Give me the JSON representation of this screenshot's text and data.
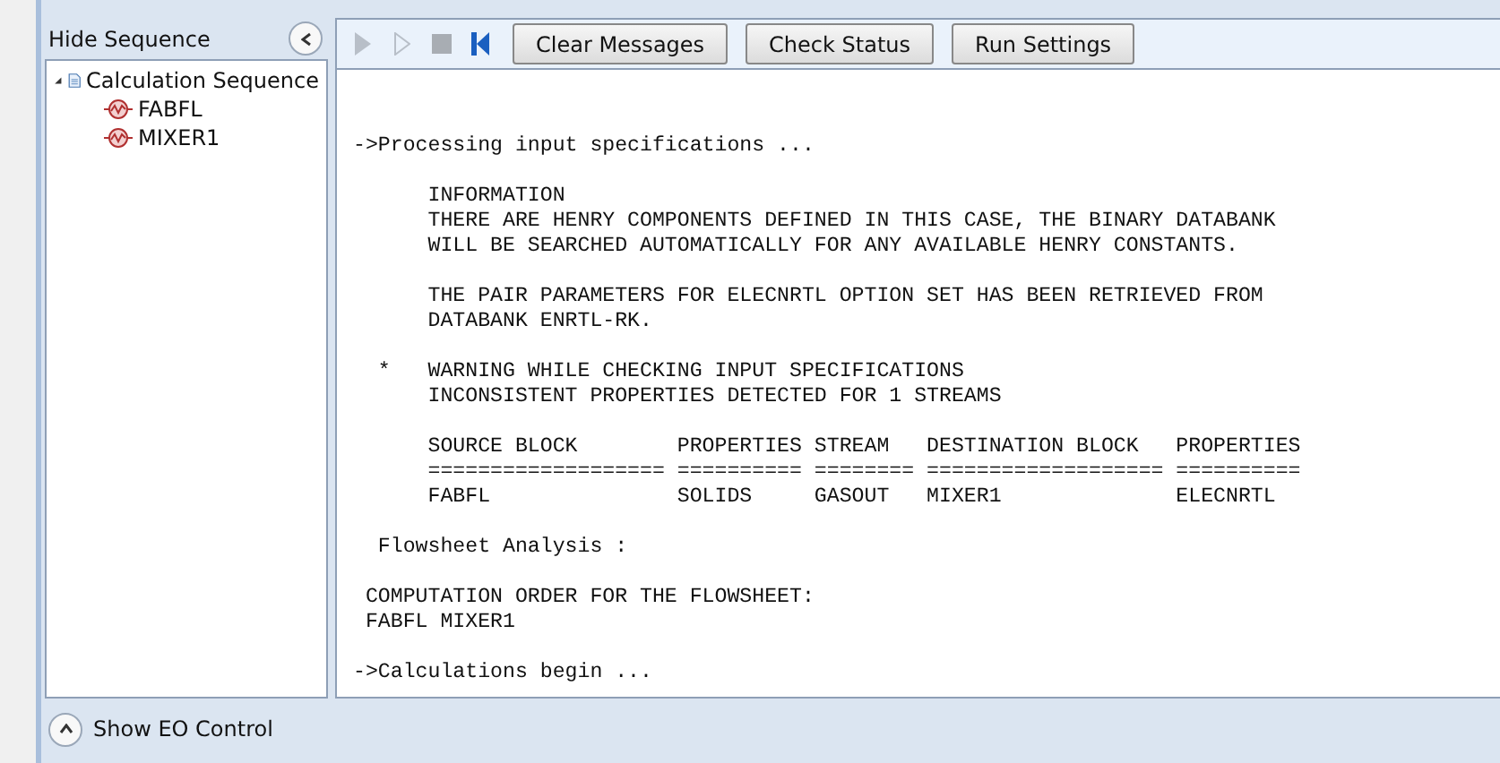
{
  "sequence_panel": {
    "title": "Hide Sequence",
    "tree": [
      {
        "label": "Calculation Sequence",
        "expanded": true,
        "children": [
          {
            "label": "FABFL"
          },
          {
            "label": "MIXER1"
          }
        ]
      }
    ]
  },
  "toolbar": {
    "buttons": [
      "Clear Messages",
      "Check Status",
      "Run Settings"
    ]
  },
  "log": [
    [
      "->Processing input specifications ..."
    ],
    [
      "      INFORMATION",
      "      THERE ARE HENRY COMPONENTS DEFINED IN THIS CASE, THE BINARY DATABANK",
      "      WILL BE SEARCHED AUTOMATICALLY FOR ANY AVAILABLE HENRY CONSTANTS."
    ],
    [
      "      THE PAIR PARAMETERS FOR ELECNRTL OPTION SET HAS BEEN RETRIEVED FROM",
      "      DATABANK ENRTL-RK."
    ],
    [
      "  *   WARNING WHILE CHECKING INPUT SPECIFICATIONS",
      "      INCONSISTENT PROPERTIES DETECTED FOR 1 STREAMS"
    ],
    [
      "      SOURCE BLOCK        PROPERTIES STREAM   DESTINATION BLOCK   PROPERTIES",
      "      =================== ========== ======== =================== ==========",
      "      FABFL               SOLIDS     GASOUT   MIXER1              ELECNRTL"
    ],
    [
      "  Flowsheet Analysis :"
    ],
    [
      " COMPUTATION ORDER FOR THE FLOWSHEET:",
      " FABFL MIXER1"
    ],
    [
      "->Calculations begin ..."
    ]
  ],
  "footer": {
    "label": "Show EO Control"
  }
}
